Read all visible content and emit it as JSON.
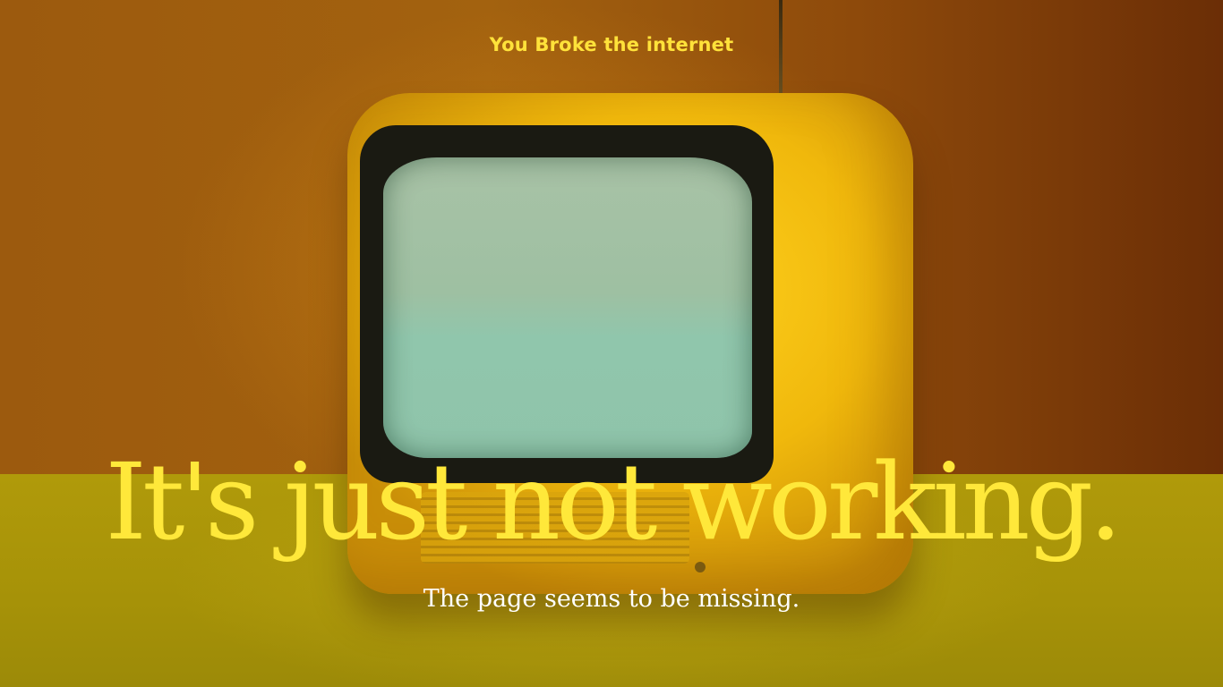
{
  "header": {
    "eyebrow": "You Broke the internet"
  },
  "hero": {
    "headline": "It's just not working.",
    "subline": "The page seems to be missing."
  },
  "background_image": {
    "description_icon": "yellow-retro-tv-static-image"
  },
  "colors": {
    "accent_yellow": "#ffe83a",
    "subtext_white": "#ffffff"
  }
}
